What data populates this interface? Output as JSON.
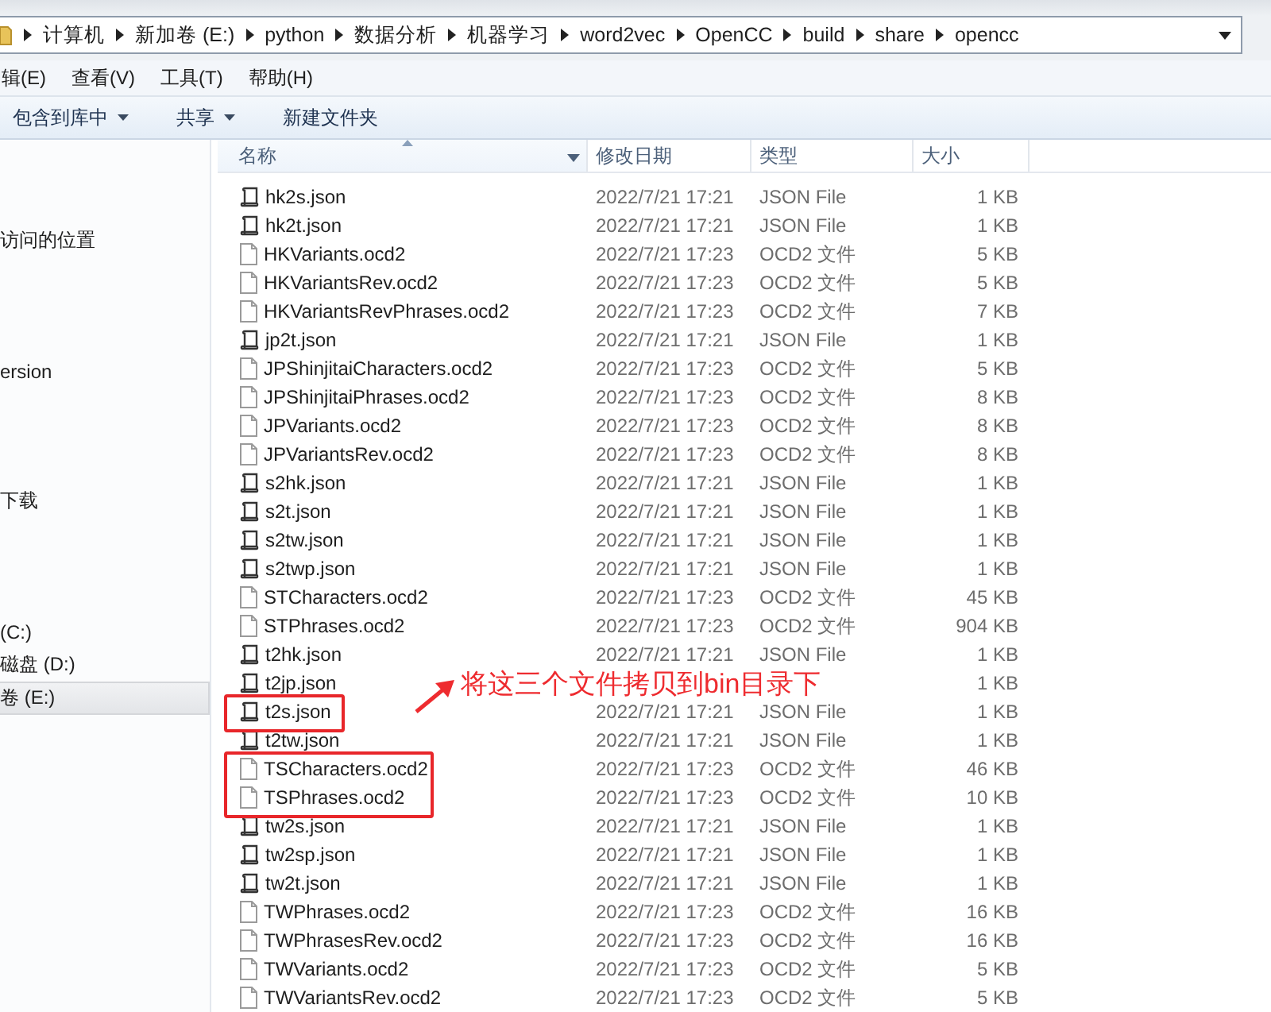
{
  "address_bar": {
    "segments": [
      "计算机",
      "新加卷 (E:)",
      "python",
      "数据分析",
      "机器学习",
      "word2vec",
      "OpenCC",
      "build",
      "share",
      "opencc"
    ]
  },
  "menu_bar": [
    "辑(E)",
    "查看(V)",
    "工具(T)",
    "帮助(H)"
  ],
  "toolbar": [
    {
      "label": "包含到库中",
      "dropdown": true
    },
    {
      "label": "共享",
      "dropdown": true
    },
    {
      "label": "新建文件夹",
      "dropdown": false
    }
  ],
  "sidebar": {
    "groups": [
      {
        "items": [
          {
            "label": "访问的位置",
            "selected": false
          }
        ]
      },
      {
        "items": [
          {
            "label": "ersion",
            "selected": false
          }
        ]
      },
      {
        "items": [
          {
            "label": "下载",
            "selected": false
          }
        ]
      },
      {
        "items": [
          {
            "label": "(C:)",
            "selected": false
          },
          {
            "label": "磁盘 (D:)",
            "selected": false
          },
          {
            "label": "卷 (E:)",
            "selected": true
          }
        ]
      }
    ]
  },
  "table": {
    "columns": [
      "名称",
      "修改日期",
      "类型",
      "大小"
    ],
    "rows": [
      {
        "kind": "json",
        "name": "hk2s.json",
        "date": "2022/7/21 17:21",
        "type": "JSON File",
        "size": "1 KB",
        "highlighted": false
      },
      {
        "kind": "json",
        "name": "hk2t.json",
        "date": "2022/7/21 17:21",
        "type": "JSON File",
        "size": "1 KB",
        "highlighted": false
      },
      {
        "kind": "ocd2",
        "name": "HKVariants.ocd2",
        "date": "2022/7/21 17:23",
        "type": "OCD2 文件",
        "size": "5 KB",
        "highlighted": false
      },
      {
        "kind": "ocd2",
        "name": "HKVariantsRev.ocd2",
        "date": "2022/7/21 17:23",
        "type": "OCD2 文件",
        "size": "5 KB",
        "highlighted": false
      },
      {
        "kind": "ocd2",
        "name": "HKVariantsRevPhrases.ocd2",
        "date": "2022/7/21 17:23",
        "type": "OCD2 文件",
        "size": "7 KB",
        "highlighted": false
      },
      {
        "kind": "json",
        "name": "jp2t.json",
        "date": "2022/7/21 17:21",
        "type": "JSON File",
        "size": "1 KB",
        "highlighted": false
      },
      {
        "kind": "ocd2",
        "name": "JPShinjitaiCharacters.ocd2",
        "date": "2022/7/21 17:23",
        "type": "OCD2 文件",
        "size": "5 KB",
        "highlighted": false
      },
      {
        "kind": "ocd2",
        "name": "JPShinjitaiPhrases.ocd2",
        "date": "2022/7/21 17:23",
        "type": "OCD2 文件",
        "size": "8 KB",
        "highlighted": false
      },
      {
        "kind": "ocd2",
        "name": "JPVariants.ocd2",
        "date": "2022/7/21 17:23",
        "type": "OCD2 文件",
        "size": "8 KB",
        "highlighted": false
      },
      {
        "kind": "ocd2",
        "name": "JPVariantsRev.ocd2",
        "date": "2022/7/21 17:23",
        "type": "OCD2 文件",
        "size": "8 KB",
        "highlighted": false
      },
      {
        "kind": "json",
        "name": "s2hk.json",
        "date": "2022/7/21 17:21",
        "type": "JSON File",
        "size": "1 KB",
        "highlighted": false
      },
      {
        "kind": "json",
        "name": "s2t.json",
        "date": "2022/7/21 17:21",
        "type": "JSON File",
        "size": "1 KB",
        "highlighted": false
      },
      {
        "kind": "json",
        "name": "s2tw.json",
        "date": "2022/7/21 17:21",
        "type": "JSON File",
        "size": "1 KB",
        "highlighted": false
      },
      {
        "kind": "json",
        "name": "s2twp.json",
        "date": "2022/7/21 17:21",
        "type": "JSON File",
        "size": "1 KB",
        "highlighted": false
      },
      {
        "kind": "ocd2",
        "name": "STCharacters.ocd2",
        "date": "2022/7/21 17:23",
        "type": "OCD2 文件",
        "size": "45 KB",
        "highlighted": false
      },
      {
        "kind": "ocd2",
        "name": "STPhrases.ocd2",
        "date": "2022/7/21 17:23",
        "type": "OCD2 文件",
        "size": "904 KB",
        "highlighted": false
      },
      {
        "kind": "json",
        "name": "t2hk.json",
        "date": "2022/7/21 17:21",
        "type": "JSON File",
        "size": "1 KB",
        "highlighted": false
      },
      {
        "kind": "json",
        "name": "t2jp.json",
        "size": "1 KB",
        "highlighted": false
      },
      {
        "kind": "json",
        "name": "t2s.json",
        "date": "2022/7/21 17:21",
        "type": "JSON File",
        "size": "1 KB",
        "highlighted": true
      },
      {
        "kind": "json",
        "name": "t2tw.json",
        "date": "2022/7/21 17:21",
        "type": "JSON File",
        "size": "1 KB",
        "highlighted": false
      },
      {
        "kind": "ocd2",
        "name": "TSCharacters.ocd2",
        "date": "2022/7/21 17:23",
        "type": "OCD2 文件",
        "size": "46 KB",
        "highlighted": true
      },
      {
        "kind": "ocd2",
        "name": "TSPhrases.ocd2",
        "date": "2022/7/21 17:23",
        "type": "OCD2 文件",
        "size": "10 KB",
        "highlighted": true
      },
      {
        "kind": "json",
        "name": "tw2s.json",
        "date": "2022/7/21 17:21",
        "type": "JSON File",
        "size": "1 KB",
        "highlighted": false
      },
      {
        "kind": "json",
        "name": "tw2sp.json",
        "date": "2022/7/21 17:21",
        "type": "JSON File",
        "size": "1 KB",
        "highlighted": false
      },
      {
        "kind": "json",
        "name": "tw2t.json",
        "date": "2022/7/21 17:21",
        "type": "JSON File",
        "size": "1 KB",
        "highlighted": false
      },
      {
        "kind": "ocd2",
        "name": "TWPhrases.ocd2",
        "date": "2022/7/21 17:23",
        "type": "OCD2 文件",
        "size": "16 KB",
        "highlighted": false
      },
      {
        "kind": "ocd2",
        "name": "TWPhrasesRev.ocd2",
        "date": "2022/7/21 17:23",
        "type": "OCD2 文件",
        "size": "16 KB",
        "highlighted": false
      },
      {
        "kind": "ocd2",
        "name": "TWVariants.ocd2",
        "date": "2022/7/21 17:23",
        "type": "OCD2 文件",
        "size": "5 KB",
        "highlighted": false
      },
      {
        "kind": "ocd2",
        "name": "TWVariantsRev.ocd2",
        "date": "2022/7/21 17:23",
        "type": "OCD2 文件",
        "size": "5 KB",
        "highlighted": false
      }
    ]
  },
  "annotation": {
    "text": "将这三个文件拷贝到bin目录下"
  }
}
